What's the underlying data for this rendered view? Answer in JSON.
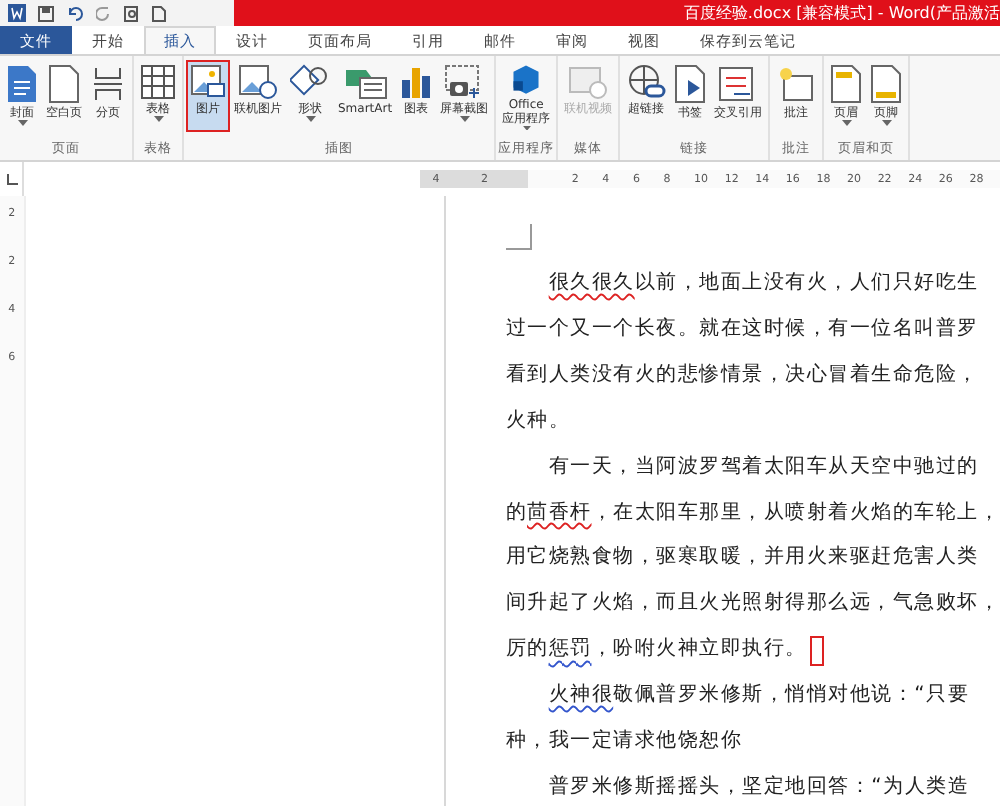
{
  "window": {
    "title": "百度经验.docx [兼容模式] - Word(产品激活"
  },
  "tabs": [
    {
      "label": "文件",
      "kind": "file",
      "selected": false
    },
    {
      "label": "开始",
      "kind": "tab",
      "selected": false
    },
    {
      "label": "插入",
      "kind": "tab",
      "selected": true
    },
    {
      "label": "设计",
      "kind": "tab",
      "selected": false
    },
    {
      "label": "页面布局",
      "kind": "tab",
      "selected": false
    },
    {
      "label": "引用",
      "kind": "tab",
      "selected": false
    },
    {
      "label": "邮件",
      "kind": "tab",
      "selected": false
    },
    {
      "label": "审阅",
      "kind": "tab",
      "selected": false
    },
    {
      "label": "视图",
      "kind": "tab",
      "selected": false
    },
    {
      "label": "保存到云笔记",
      "kind": "tab",
      "selected": false
    }
  ],
  "ribbon_groups": [
    {
      "label": "页面",
      "buttons": [
        {
          "label": "封面",
          "dropdown": true,
          "selected": false,
          "disabled": false
        },
        {
          "label": "空白页",
          "dropdown": false,
          "selected": false,
          "disabled": false
        },
        {
          "label": "分页",
          "dropdown": false,
          "selected": false,
          "disabled": false
        }
      ]
    },
    {
      "label": "表格",
      "buttons": [
        {
          "label": "表格",
          "dropdown": true,
          "selected": false,
          "disabled": false
        }
      ]
    },
    {
      "label": "插图",
      "buttons": [
        {
          "label": "图片",
          "dropdown": false,
          "selected": true,
          "disabled": false
        },
        {
          "label": "联机图片",
          "dropdown": false,
          "selected": false,
          "disabled": false
        },
        {
          "label": "形状",
          "dropdown": true,
          "selected": false,
          "disabled": false
        },
        {
          "label": "SmartArt",
          "dropdown": false,
          "selected": false,
          "disabled": false
        },
        {
          "label": "图表",
          "dropdown": false,
          "selected": false,
          "disabled": false
        },
        {
          "label": "屏幕截图",
          "dropdown": true,
          "selected": false,
          "disabled": false
        }
      ]
    },
    {
      "label": "应用程序",
      "buttons": [
        {
          "label": "Office\n应用程序",
          "dropdown": true,
          "selected": false,
          "disabled": false
        }
      ]
    },
    {
      "label": "媒体",
      "buttons": [
        {
          "label": "联机视频",
          "dropdown": false,
          "selected": false,
          "disabled": true
        }
      ]
    },
    {
      "label": "链接",
      "buttons": [
        {
          "label": "超链接",
          "dropdown": false,
          "selected": false,
          "disabled": false
        },
        {
          "label": "书签",
          "dropdown": false,
          "selected": false,
          "disabled": false
        },
        {
          "label": "交叉引用",
          "dropdown": false,
          "selected": false,
          "disabled": false
        }
      ]
    },
    {
      "label": "批注",
      "buttons": [
        {
          "label": "批注",
          "dropdown": false,
          "selected": false,
          "disabled": false
        }
      ]
    },
    {
      "label": "页眉和页",
      "buttons": [
        {
          "label": "页眉",
          "dropdown": true,
          "selected": false,
          "disabled": false
        },
        {
          "label": "页脚",
          "dropdown": true,
          "selected": false,
          "disabled": false
        }
      ]
    }
  ],
  "ruler": {
    "left_ticks": [
      "4",
      "2"
    ],
    "ticks": [
      "2",
      "4",
      "6",
      "8",
      "10",
      "12",
      "14",
      "16",
      "18",
      "20",
      "22",
      "24",
      "26",
      "28"
    ],
    "vertical_ticks": [
      "2",
      "2",
      "4",
      "6"
    ]
  },
  "document": {
    "paragraphs": [
      {
        "indent": true,
        "cursor": false,
        "parts": [
          {
            "text": "很久很久",
            "spelling_error": true,
            "grammar_error": false
          },
          {
            "text": "以前，地面上没有火，人们只好吃生",
            "spelling_error": false,
            "grammar_error": false
          }
        ]
      },
      {
        "indent": false,
        "cursor": false,
        "parts": [
          {
            "text": "过一个又一个长夜。就在这时候，有一位名叫普罗",
            "spelling_error": false,
            "grammar_error": false
          }
        ]
      },
      {
        "indent": false,
        "cursor": false,
        "parts": [
          {
            "text": "看到人类没有火的悲惨情景，决心冒着生命危险，",
            "spelling_error": false,
            "grammar_error": false
          }
        ]
      },
      {
        "indent": false,
        "cursor": false,
        "parts": [
          {
            "text": "火种。",
            "spelling_error": false,
            "grammar_error": false
          }
        ]
      },
      {
        "indent": true,
        "cursor": false,
        "parts": [
          {
            "text": "有一天，当阿波罗驾着太阳车从天空中驰过的",
            "spelling_error": false,
            "grammar_error": false
          }
        ]
      },
      {
        "indent": false,
        "cursor": false,
        "parts": [
          {
            "text": "的",
            "spelling_error": false,
            "grammar_error": false
          },
          {
            "text": "茴香杆",
            "spelling_error": true,
            "grammar_error": false
          },
          {
            "text": "，在太阳车那里，从喷射着火焰的车轮上，",
            "spelling_error": false,
            "grammar_error": false
          }
        ]
      },
      {
        "indent": false,
        "cursor": false,
        "parts": [
          {
            "text": "用它烧熟食物，驱寒取暖，并用火来驱赶危害人类",
            "spelling_error": false,
            "grammar_error": false
          }
        ]
      },
      {
        "indent": false,
        "cursor": false,
        "parts": [
          {
            "text": "间升起了火焰，而且火光照射得那么远，气急败坏，",
            "spelling_error": false,
            "grammar_error": false
          }
        ]
      },
      {
        "indent": false,
        "cursor": true,
        "parts": [
          {
            "text": "厉的",
            "spelling_error": false,
            "grammar_error": false
          },
          {
            "text": "惩罚",
            "spelling_error": false,
            "grammar_error": true
          },
          {
            "text": "，吩咐火神立即执行。",
            "spelling_error": false,
            "grammar_error": false
          }
        ]
      },
      {
        "indent": true,
        "cursor": false,
        "parts": [
          {
            "text": "火神很",
            "spelling_error": false,
            "grammar_error": true
          },
          {
            "text": "敬佩普罗米修斯，悄悄对他说：“只要",
            "spelling_error": false,
            "grammar_error": false
          }
        ]
      },
      {
        "indent": false,
        "cursor": false,
        "parts": [
          {
            "text": "种，我一定请求他饶恕你",
            "spelling_error": false,
            "grammar_error": false
          }
        ]
      },
      {
        "indent": true,
        "cursor": false,
        "parts": [
          {
            "text": "普罗米修斯摇摇头，坚定地回答：“为人类造",
            "spelling_error": false,
            "grammar_error": false
          }
        ]
      }
    ]
  }
}
